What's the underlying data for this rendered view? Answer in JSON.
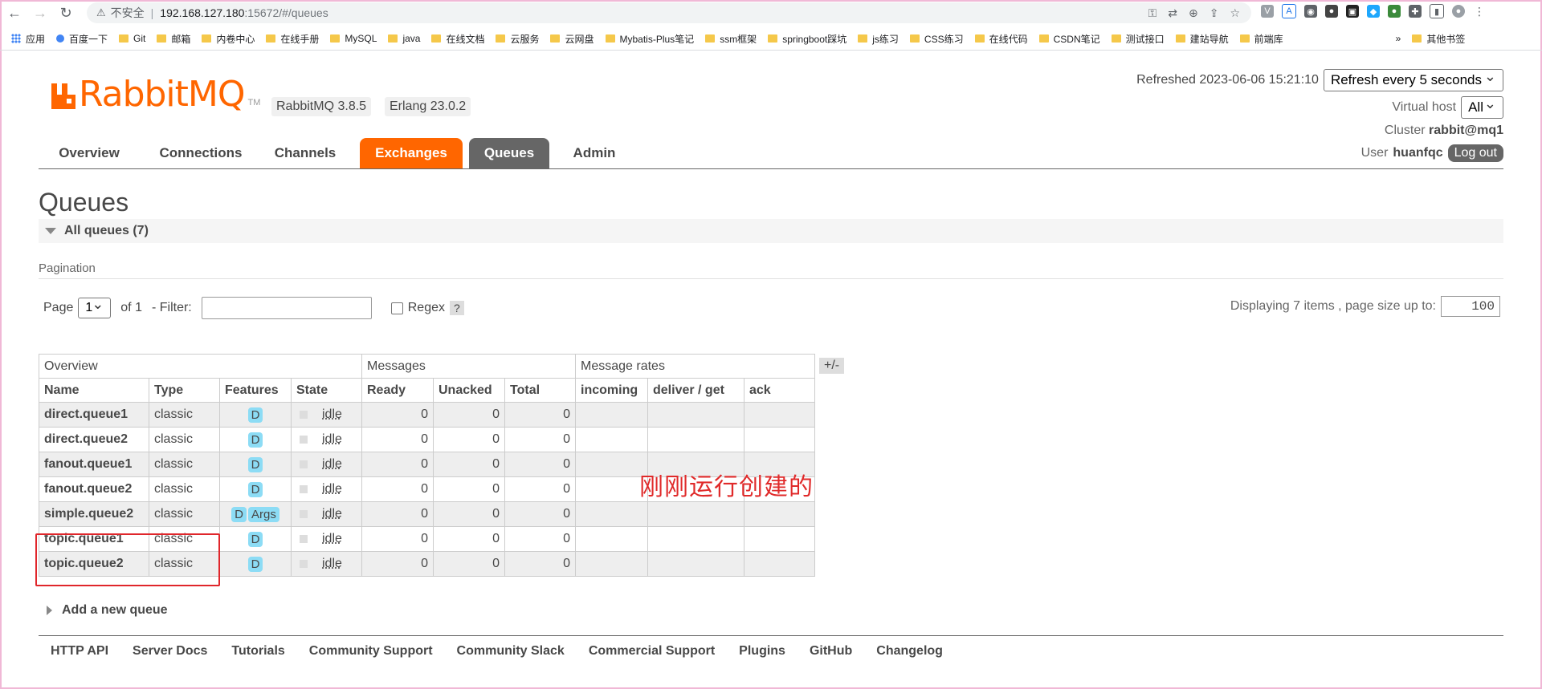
{
  "browser": {
    "security_label": "不安全",
    "url_host": "192.168.127.180",
    "url_path": ":15672/#/queues",
    "bookmarks": [
      "应用",
      "百度一下",
      "Git",
      "邮箱",
      "内卷中心",
      "在线手册",
      "MySQL",
      "java",
      "在线文档",
      "云服务",
      "云网盘",
      "Mybatis-Plus笔记",
      "ssm框架",
      "springboot踩坑",
      "js练习",
      "CSS练习",
      "在线代码",
      "CSDN笔记",
      "测试接口",
      "建站导航",
      "前端库",
      "»",
      "其他书签"
    ]
  },
  "header": {
    "logo_text": "RabbitMQ",
    "logo_tm": "TM",
    "version": "RabbitMQ 3.8.5",
    "erlang": "Erlang 23.0.2",
    "refreshed_label": "Refreshed 2023-06-06 15:21:10",
    "refresh_select": "Refresh every 5 seconds",
    "vhost_label": "Virtual host",
    "vhost_value": "All",
    "cluster_label": "Cluster",
    "cluster_value": "rabbit@mq1",
    "user_label": "User",
    "user_value": "huanfqc",
    "logout": "Log out"
  },
  "tabs": [
    "Overview",
    "Connections",
    "Channels",
    "Exchanges",
    "Queues",
    "Admin"
  ],
  "page": {
    "title": "Queues",
    "section": "All queues (7)",
    "pagination_label": "Pagination",
    "page_label": "Page",
    "page_value": "1",
    "of_label": "of 1",
    "filter_label": "- Filter:",
    "regex_label": "Regex",
    "help": "?",
    "displaying": "Displaying 7 items , page size up to:",
    "page_size": "100"
  },
  "table": {
    "groups": [
      "Overview",
      "Messages",
      "Message rates"
    ],
    "toggle": "+/-",
    "columns": [
      "Name",
      "Type",
      "Features",
      "State",
      "Ready",
      "Unacked",
      "Total",
      "incoming",
      "deliver / get",
      "ack"
    ],
    "rows": [
      {
        "name": "direct.queue1",
        "type": "classic",
        "features": [
          "D"
        ],
        "state": "idle",
        "ready": "0",
        "unacked": "0",
        "total": "0"
      },
      {
        "name": "direct.queue2",
        "type": "classic",
        "features": [
          "D"
        ],
        "state": "idle",
        "ready": "0",
        "unacked": "0",
        "total": "0"
      },
      {
        "name": "fanout.queue1",
        "type": "classic",
        "features": [
          "D"
        ],
        "state": "idle",
        "ready": "0",
        "unacked": "0",
        "total": "0"
      },
      {
        "name": "fanout.queue2",
        "type": "classic",
        "features": [
          "D"
        ],
        "state": "idle",
        "ready": "0",
        "unacked": "0",
        "total": "0"
      },
      {
        "name": "simple.queue2",
        "type": "classic",
        "features": [
          "D",
          "Args"
        ],
        "state": "idle",
        "ready": "0",
        "unacked": "0",
        "total": "0"
      },
      {
        "name": "topic.queue1",
        "type": "classic",
        "features": [
          "D"
        ],
        "state": "idle",
        "ready": "0",
        "unacked": "0",
        "total": "0"
      },
      {
        "name": "topic.queue2",
        "type": "classic",
        "features": [
          "D"
        ],
        "state": "idle",
        "ready": "0",
        "unacked": "0",
        "total": "0"
      }
    ]
  },
  "annotation": "刚刚运行创建的",
  "add_queue": "Add a new queue",
  "footer": [
    "HTTP API",
    "Server Docs",
    "Tutorials",
    "Community Support",
    "Community Slack",
    "Commercial Support",
    "Plugins",
    "GitHub",
    "Changelog"
  ],
  "colors": {
    "brand": "#ff6600",
    "active_tab": "#666666",
    "feature_badge": "#8cdcf5",
    "annotation": "#e02a2a"
  }
}
